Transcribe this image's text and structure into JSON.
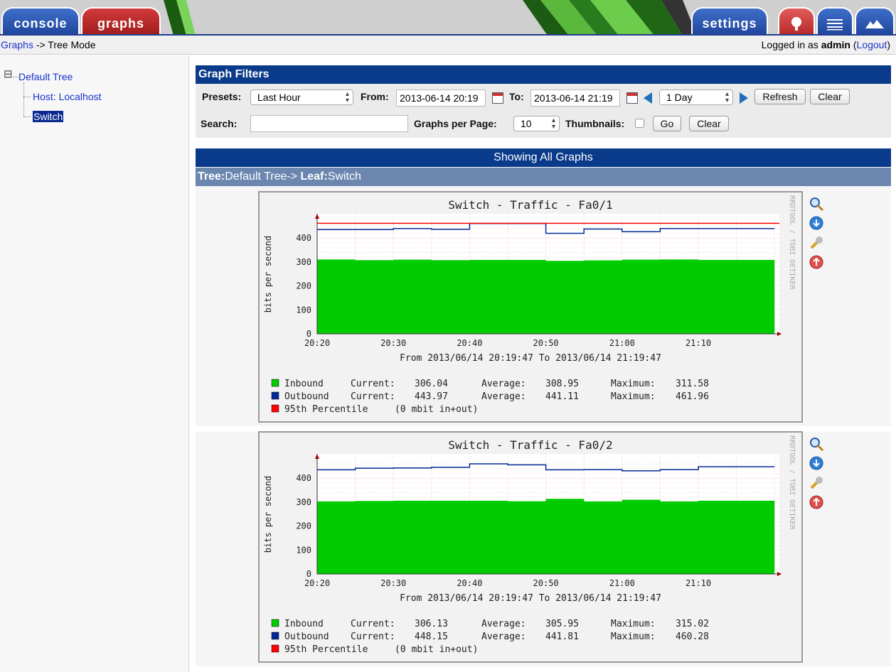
{
  "header": {
    "tabs": [
      {
        "label": "console",
        "active": false
      },
      {
        "label": "graphs",
        "active": true
      }
    ],
    "settings_label": "settings",
    "icons": [
      "tree-view-icon",
      "list-view-icon",
      "preview-view-icon"
    ]
  },
  "breadcrumb": {
    "root": "Graphs",
    "separator": "->",
    "current": "Tree Mode",
    "login_prefix": "Logged in as",
    "user": "admin",
    "logout_open": "(",
    "logout": "Logout",
    "logout_close": ")"
  },
  "tree": {
    "root": "Default Tree",
    "expander": "⊟",
    "items": [
      "Host: Localhost",
      "Switch"
    ],
    "selected": "Switch"
  },
  "filters": {
    "title": "Graph Filters",
    "presets_label": "Presets:",
    "presets_value": "Last Hour",
    "from_label": "From:",
    "from_value": "2013-06-14 20:19",
    "to_label": "To:",
    "to_value": "2013-06-14 21:19",
    "span_value": "1 Day",
    "refresh_label": "Refresh",
    "clear_label": "Clear",
    "search_label": "Search:",
    "search_value": "",
    "per_page_label": "Graphs per Page:",
    "per_page_value": "10",
    "thumbnails_label": "Thumbnails:",
    "thumbnails_checked": false,
    "go_label": "Go",
    "clear2_label": "Clear"
  },
  "showing": "Showing All Graphs",
  "tree_path": {
    "tree_label": "Tree:",
    "tree_value": "Default Tree->",
    "leaf_label": "Leaf:",
    "leaf_value": "Switch"
  },
  "graph_icons": [
    "zoom-icon",
    "csv-export-icon",
    "graph-properties-icon",
    "realtime-icon"
  ],
  "colors": {
    "inbound": "#00cc00",
    "outbound": "#002a97",
    "percentile": "#ff0000"
  },
  "chart_data": [
    {
      "type": "area",
      "title": "Switch - Traffic - Fa0/1",
      "ylabel": "bits per second",
      "watermark": "RRDTOOL / TOBI OETIKER",
      "ylim": [
        0,
        460
      ],
      "yticks": [
        0,
        100,
        200,
        300,
        400
      ],
      "xticks": [
        "20:20",
        "20:30",
        "20:40",
        "20:50",
        "21:00",
        "21:10"
      ],
      "time_range": "From 2013/06/14 20:19:47 To 2013/06/14 21:19:47",
      "x": [
        "20:20",
        "20:25",
        "20:30",
        "20:35",
        "20:40",
        "20:45",
        "20:50",
        "20:55",
        "21:00",
        "21:05",
        "21:10",
        "21:15"
      ],
      "series": [
        {
          "name": "Inbound",
          "values": [
            311,
            308,
            310,
            308,
            309,
            309,
            305,
            307,
            310,
            311,
            309,
            309
          ],
          "current": "306.04",
          "average": "308.95",
          "maximum": "311.58"
        },
        {
          "name": "Outbound",
          "values": [
            436,
            436,
            440,
            437,
            461,
            461,
            420,
            438,
            427,
            440,
            440,
            440
          ],
          "current": "443.97",
          "average": "441.11",
          "maximum": "461.96"
        }
      ],
      "percentile": {
        "name": "95th Percentile",
        "text": "(0 mbit in+out)",
        "value": 462
      },
      "legend_labels": {
        "current": "Current:",
        "average": "Average:",
        "maximum": "Maximum:"
      }
    },
    {
      "type": "area",
      "title": "Switch - Traffic - Fa0/2",
      "ylabel": "bits per second",
      "watermark": "RRDTOOL / TOBI OETIKER",
      "ylim": [
        0,
        460
      ],
      "yticks": [
        0,
        100,
        200,
        300,
        400
      ],
      "xticks": [
        "20:20",
        "20:30",
        "20:40",
        "20:50",
        "21:00",
        "21:10"
      ],
      "time_range": "From 2013/06/14 20:19:47 To 2013/06/14 21:19:47",
      "x": [
        "20:20",
        "20:25",
        "20:30",
        "20:35",
        "20:40",
        "20:45",
        "20:50",
        "20:55",
        "21:00",
        "21:05",
        "21:10",
        "21:15"
      ],
      "series": [
        {
          "name": "Inbound",
          "values": [
            303,
            305,
            306,
            306,
            306,
            304,
            314,
            303,
            310,
            303,
            306,
            306
          ],
          "current": "306.13",
          "average": "305.95",
          "maximum": "315.02"
        },
        {
          "name": "Outbound",
          "values": [
            435,
            442,
            443,
            446,
            460,
            456,
            435,
            436,
            431,
            436,
            448,
            448
          ],
          "current": "448.15",
          "average": "441.81",
          "maximum": "460.28"
        }
      ],
      "percentile": {
        "name": "95th Percentile",
        "text": "(0 mbit in+out)",
        "value": null
      },
      "legend_labels": {
        "current": "Current:",
        "average": "Average:",
        "maximum": "Maximum:"
      }
    }
  ]
}
